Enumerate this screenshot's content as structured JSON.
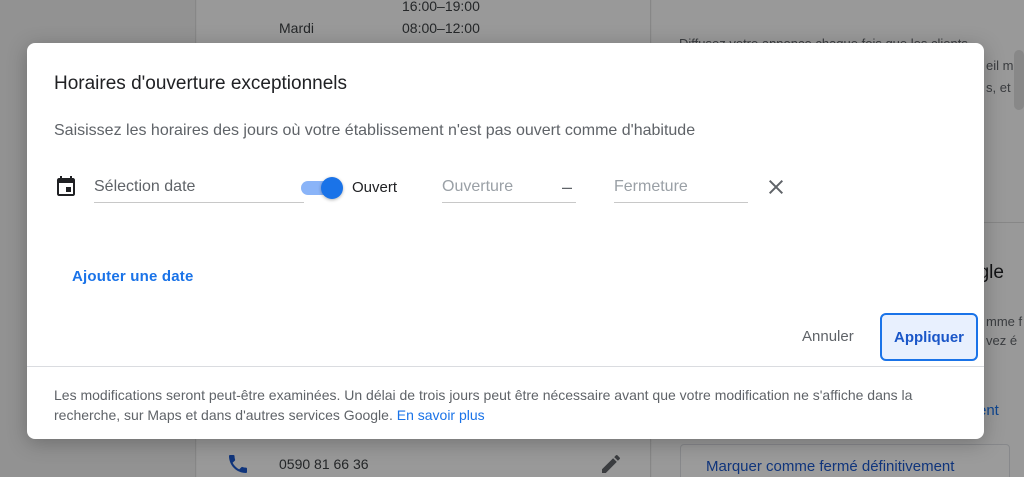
{
  "background": {
    "hours_top": "16:00–19:00",
    "day": "Mardi",
    "hours": "08:00–12:00",
    "phone": "0590 81 66 36",
    "right_line1": "Diffusez votre annonce chaque fois que les clients",
    "right_line2": "eil mo",
    "right_line3": "s, et v",
    "right_heading_fragment": "ogle",
    "right_line4": "mme f",
    "right_line5": "vez é",
    "right_link_fragment": "ent",
    "closed_permanently": "Marquer comme fermé définitivement"
  },
  "dialog": {
    "title": "Horaires d'ouverture exceptionnels",
    "subtitle": "Saisissez les horaires des jours où votre établissement n'est pas ouvert comme d'habitude",
    "date_placeholder": "Sélection date",
    "switch_label": "Ouvert",
    "switch_on": true,
    "opening_placeholder": "Ouverture",
    "dash": "–",
    "closing_placeholder": "Fermeture",
    "add_date": "Ajouter une date",
    "cancel": "Annuler",
    "apply": "Appliquer",
    "footer_text": "Les modifications seront peut-être examinées. Un délai de trois jours peut être nécessaire avant que votre modification ne s'affiche dans la recherche, sur Maps et dans d'autres services Google.",
    "footer_link": "En savoir plus"
  },
  "colors": {
    "accent": "#1a73e8",
    "switch_track": "#8ab4f8"
  }
}
